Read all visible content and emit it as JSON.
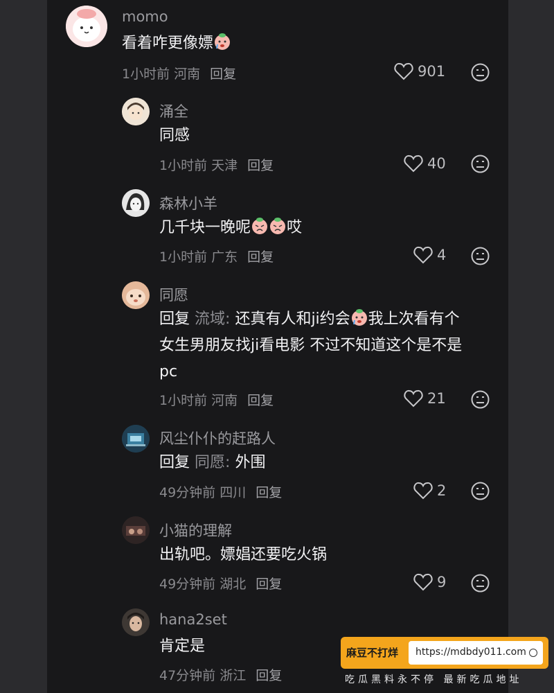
{
  "colors": {
    "panel_bg": "#18181a",
    "side_bg": "#2b2b2e",
    "banner_orange": "#f4a51c"
  },
  "comments": [
    {
      "name": "momo",
      "text": "看着咋更像嫖",
      "emoji": "face-icon",
      "time": "1小时前",
      "location": "河南",
      "reply": "回复",
      "likes": "901"
    },
    {
      "name": "涌全",
      "text": "同感",
      "time": "1小时前",
      "location": "天津",
      "reply": "回复",
      "likes": "40"
    },
    {
      "name": "森林小羊",
      "text_before": "几千块一晚呢",
      "text_after": "哎",
      "time": "1小时前",
      "location": "广东",
      "reply": "回复",
      "likes": "4"
    },
    {
      "name": "同愿",
      "reply_prefix": "回复",
      "reply_to": "流域:",
      "line1_a": "还真有人和ji约会",
      "line1_b": "我上次看有个",
      "line2": "女生男朋友找ji看电影 不过不知道这个是不是",
      "line3": "pc",
      "time": "1小时前",
      "location": "河南",
      "reply": "回复",
      "likes": "21"
    },
    {
      "name": "风尘仆仆的赶路人",
      "reply_prefix": "回复",
      "reply_to": "同愿:",
      "text": "外围",
      "time": "49分钟前",
      "location": "四川",
      "reply": "回复",
      "likes": "2"
    },
    {
      "name": "小猫的理解",
      "text": "出轨吧。嫖娼还要吃火锅",
      "time": "49分钟前",
      "location": "湖北",
      "reply": "回复",
      "likes": "9"
    },
    {
      "name": "hana2set",
      "text": "肯定是",
      "time": "47分钟前",
      "location": "浙江",
      "reply": "回复"
    }
  ],
  "banner": {
    "label": "麻豆不打烊",
    "url": "https://mdbdy011.com",
    "subtitle": "吃瓜黑料永不停 最新吃瓜地址"
  }
}
